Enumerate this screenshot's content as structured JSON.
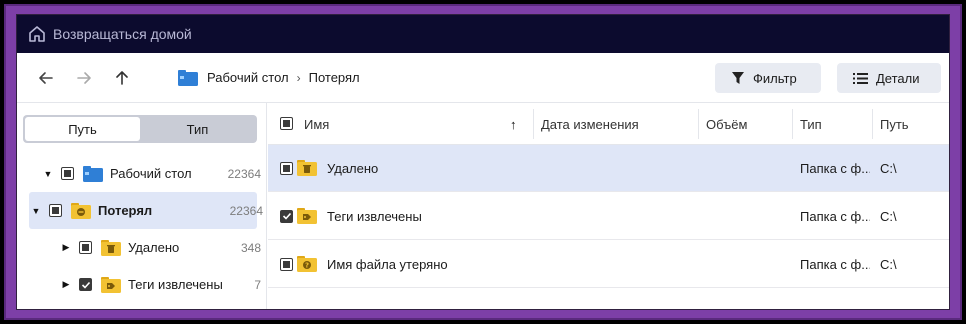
{
  "topbar": {
    "home_label": "Возвращаться домой"
  },
  "toolbar": {
    "breadcrumbs": [
      "Рабочий стол",
      "Потерял"
    ],
    "filter_label": "Фильтр",
    "details_label": "Детали"
  },
  "left": {
    "tabs": [
      "Путь",
      "Тип"
    ],
    "active_tab": "Путь",
    "tree": [
      {
        "label": "Рабочий стол",
        "count": "22364",
        "expanded": true,
        "checked": "partial",
        "icon": "desktop-folder-icon"
      },
      {
        "label": "Потерял",
        "count": "22364",
        "expanded": true,
        "checked": "partial",
        "icon": "lost-folder-icon",
        "selected": true
      },
      {
        "label": "Удалено",
        "count": "348",
        "expanded": false,
        "checked": "partial",
        "icon": "deleted-folder-icon"
      },
      {
        "label": "Теги извлечены",
        "count": "7",
        "expanded": false,
        "checked": "checked",
        "icon": "tags-folder-icon"
      }
    ]
  },
  "table": {
    "columns": [
      "Имя",
      "Дата изменения",
      "Объём",
      "Тип",
      "Путь"
    ],
    "sort_indicator": "↑",
    "rows": [
      {
        "name": "Удалено",
        "date": "",
        "size": "",
        "type": "Папка с ф...",
        "path": "C:\\",
        "checked": "partial",
        "selected": true,
        "icon": "deleted-folder-icon"
      },
      {
        "name": "Теги извлечены",
        "date": "",
        "size": "",
        "type": "Папка с ф...",
        "path": "C:\\",
        "checked": "checked",
        "selected": false,
        "icon": "tags-folder-icon"
      },
      {
        "name": "Имя файла утеряно",
        "date": "",
        "size": "",
        "type": "Папка с ф...",
        "path": "C:\\",
        "checked": "partial",
        "selected": false,
        "icon": "unknown-folder-icon"
      }
    ]
  },
  "colors": {
    "topbar": "#0c0b2e",
    "frame": "#7d3fa7",
    "selection": "#dfe6f7",
    "folder": "#f2c233",
    "accent": "#2f7fd6"
  }
}
